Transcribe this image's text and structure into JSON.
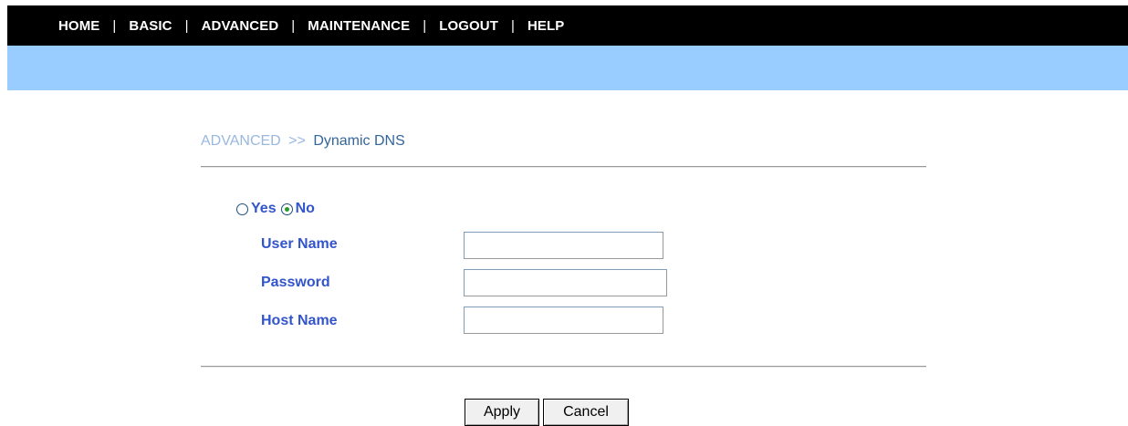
{
  "nav": {
    "items": [
      {
        "label": "HOME"
      },
      {
        "label": "BASIC"
      },
      {
        "label": "ADVANCED"
      },
      {
        "label": "MAINTENANCE"
      },
      {
        "label": "LOGOUT"
      },
      {
        "label": "HELP"
      }
    ],
    "separator": "|"
  },
  "breadcrumb": {
    "parent": "ADVANCED",
    "separator": ">>",
    "current": "Dynamic DNS"
  },
  "ddns": {
    "enable_options": [
      {
        "label": "Yes",
        "selected": false
      },
      {
        "label": "No",
        "selected": true
      }
    ],
    "fields": {
      "user_name": {
        "label": "User Name",
        "value": ""
      },
      "password": {
        "label": "Password",
        "value": ""
      },
      "host_name": {
        "label": "Host Name",
        "value": ""
      }
    }
  },
  "buttons": {
    "apply": "Apply",
    "cancel": "Cancel"
  },
  "colors": {
    "topbar": "#000000",
    "bluebar": "#99ccff",
    "label": "#3355cc",
    "breadcrumb_parent": "#99b8e0",
    "breadcrumb_current": "#336699"
  }
}
